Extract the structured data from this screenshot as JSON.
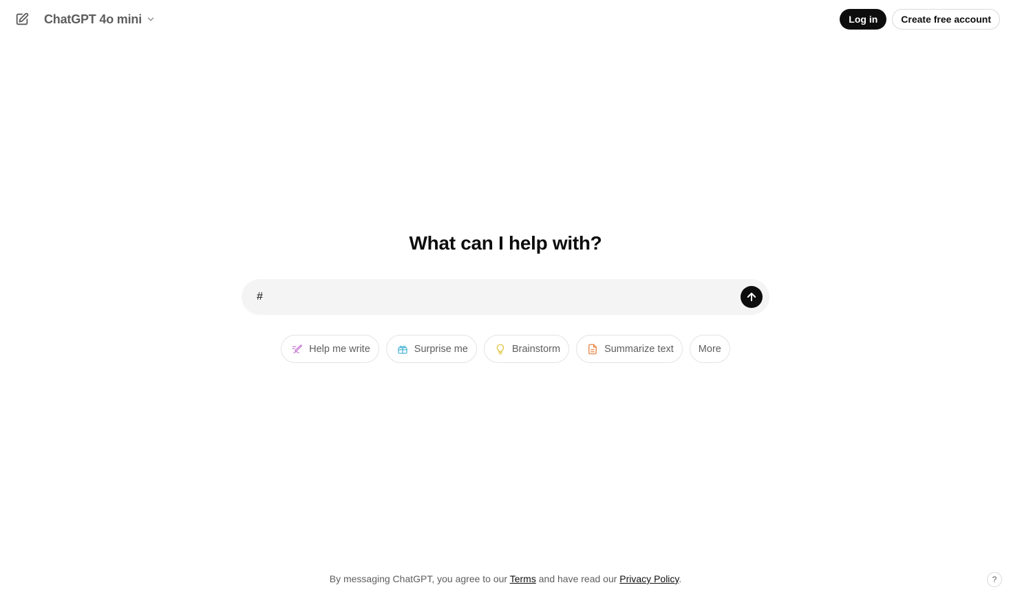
{
  "header": {
    "new_chat_icon": "edit-icon",
    "model_name": "ChatGPT 4o mini",
    "model_chevron_icon": "chevron-down-icon",
    "login_label": "Log in",
    "signup_label": "Create free account"
  },
  "main": {
    "title": "What can I help with?",
    "composer": {
      "value": "#",
      "send_icon": "arrow-up-icon"
    },
    "chips": [
      {
        "label": "Help me write",
        "icon": "pen-icon",
        "color": "#c77dd4"
      },
      {
        "label": "Surprise me",
        "icon": "gift-icon",
        "color": "#4fb8d6"
      },
      {
        "label": "Brainstorm",
        "icon": "lightbulb-icon",
        "color": "#e2c541"
      },
      {
        "label": "Summarize text",
        "icon": "document-icon",
        "color": "#ea8444"
      },
      {
        "label": "More"
      }
    ]
  },
  "footer": {
    "prefix": "By messaging ChatGPT, you agree to our ",
    "terms_label": "Terms",
    "middle": " and have read our ",
    "privacy_label": "Privacy Policy",
    "suffix": ".",
    "help_label": "?"
  }
}
